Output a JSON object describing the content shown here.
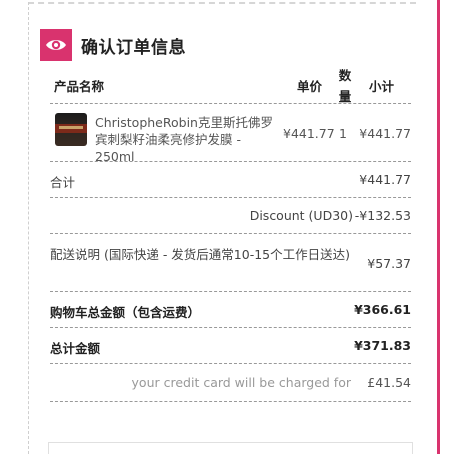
{
  "header": {
    "icon": "eye-icon",
    "accent_color": "#d9336e",
    "title": "确认订单信息"
  },
  "table": {
    "columns": {
      "name": "产品名称",
      "price": "单价",
      "qty_line1": "数",
      "qty_line2": "量",
      "subtotal": "小计"
    },
    "items": [
      {
        "name": "ChristopheRobin克里斯托佛罗宾刺梨籽油柔亮修护发膜 - 250ml",
        "price": "¥441.77",
        "qty": "1",
        "subtotal": "¥441.77"
      }
    ],
    "summary": {
      "total_label": "合计",
      "total_value": "¥441.77",
      "discount_label": "Discount (UD30)",
      "discount_value": "-¥132.53",
      "shipping_label": "配送说明 (国际快递 - 发货后通常10-15个工作日送达)",
      "shipping_value": "¥57.37",
      "cart_total_label": "购物车总金额（包含运费）",
      "cart_total_value": "¥366.61",
      "grand_total_label": "总计金额",
      "grand_total_value": "¥371.83",
      "charged_label": "your credit card will be charged for",
      "charged_value": "£41.54"
    }
  }
}
